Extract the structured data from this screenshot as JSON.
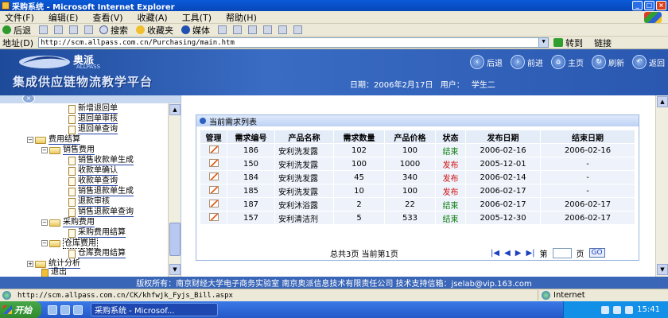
{
  "window": {
    "title": "采购系统 - Microsoft Internet Explorer"
  },
  "menu": [
    "文件(F)",
    "编辑(E)",
    "查看(V)",
    "收藏(A)",
    "工具(T)",
    "帮助(H)"
  ],
  "toolbar": {
    "back": "后退",
    "search": "搜索",
    "favorites": "收藏夹",
    "media": "媒体"
  },
  "address": {
    "label": "地址(D)",
    "url": "http://scm.allpass.com.cn/Purchasing/main.htm",
    "go": "转到",
    "links": "链接"
  },
  "header": {
    "brand": "奥派",
    "brand_sub": "ALLPASS",
    "platform": "集成供应链物流教学平台",
    "nav": [
      "后退",
      "前进",
      "主页",
      "刷新",
      "返回"
    ],
    "date_label": "日期：2006年2月17日",
    "user_label": "用户：",
    "user_name": "学生二"
  },
  "tree": {
    "items": [
      {
        "label": "新增退回单"
      },
      {
        "label": "退回单审核"
      },
      {
        "label": "退回单查询"
      },
      {
        "label": "费用结算"
      },
      {
        "label": "销售费用"
      },
      {
        "label": "销售收款单生成"
      },
      {
        "label": "收款单确认"
      },
      {
        "label": "收款单查询"
      },
      {
        "label": "销售退款单生成"
      },
      {
        "label": "退款审核"
      },
      {
        "label": "销售退款单查询"
      },
      {
        "label": "采购费用"
      },
      {
        "label": "采购费用结算"
      },
      {
        "label": "仓库费用"
      },
      {
        "label": "仓库费用结算"
      },
      {
        "label": "统计分析"
      },
      {
        "label": "退出"
      }
    ]
  },
  "list": {
    "title": "当前需求列表",
    "columns": [
      "管理",
      "需求编号",
      "产品名称",
      "需求数量",
      "产品价格",
      "状态",
      "发布日期",
      "结束日期"
    ],
    "rows": [
      {
        "id": "186",
        "product": "安利洗发露",
        "qty": "102",
        "price": "100",
        "status": "结束",
        "status_kind": "end",
        "pub": "2006-02-16",
        "end": "2006-02-16"
      },
      {
        "id": "150",
        "product": "安利洗发露",
        "qty": "100",
        "price": "1000",
        "status": "发布",
        "status_kind": "pub",
        "pub": "2005-12-01",
        "end": "-"
      },
      {
        "id": "184",
        "product": "安利洗发露",
        "qty": "45",
        "price": "340",
        "status": "发布",
        "status_kind": "pub",
        "pub": "2006-02-14",
        "end": "-"
      },
      {
        "id": "185",
        "product": "安利洗发露",
        "qty": "10",
        "price": "100",
        "status": "发布",
        "status_kind": "pub",
        "pub": "2006-02-17",
        "end": "-"
      },
      {
        "id": "187",
        "product": "安利沐浴露",
        "qty": "2",
        "price": "22",
        "status": "结束",
        "status_kind": "end",
        "pub": "2006-02-17",
        "end": "2006-02-17"
      },
      {
        "id": "157",
        "product": "安利清洁剂",
        "qty": "5",
        "price": "533",
        "status": "结束",
        "status_kind": "end",
        "pub": "2005-12-30",
        "end": "2006-02-17"
      }
    ],
    "pager": {
      "info": "总共3页 当前第1页",
      "page_prefix": "第",
      "page_suffix": "页",
      "go": "GO"
    }
  },
  "footer": "版权所有：南京财经大学电子商务实验室 南京奥派信息技术有限责任公司 技术支持信箱：jselab@vip.163.com",
  "status": {
    "url": "http://scm.allpass.com.cn/CK/khfwjk_Fyjs_Bill.aspx",
    "zone": "Internet"
  },
  "taskbar": {
    "start": "开始",
    "task": "采购系统 - Microsof...",
    "clock": "15:41"
  },
  "colors": {
    "status_end": "#108010",
    "status_pub": "#d01010",
    "header_bg": "#2a58b0"
  }
}
